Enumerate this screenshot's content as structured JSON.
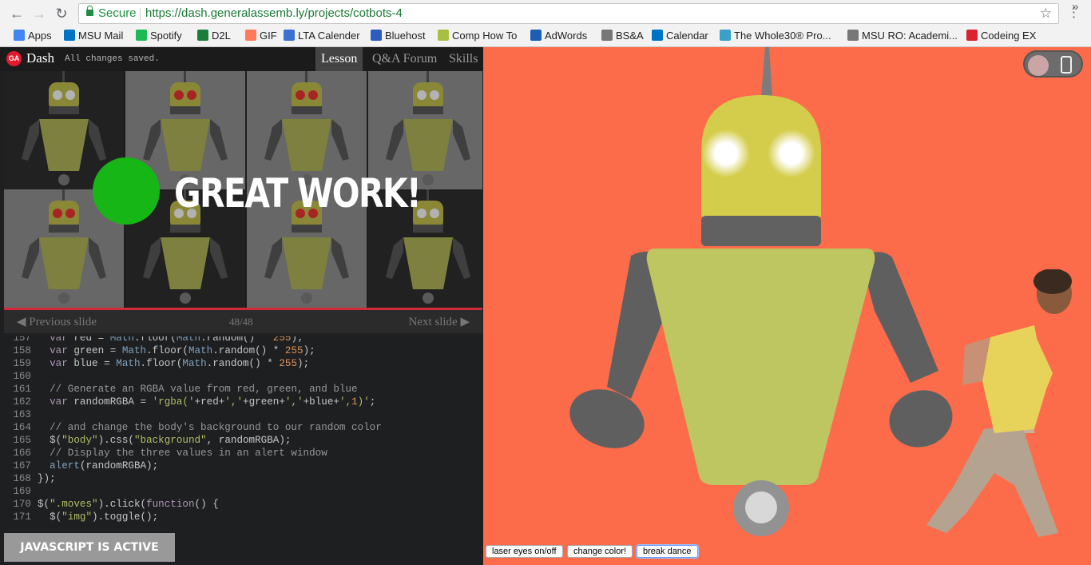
{
  "browser": {
    "secure_label": "Secure",
    "url": "https://dash.generalassemb.ly/projects/cotbots-4",
    "bookmarks": [
      {
        "label": "Apps",
        "icon": "apps-grid-icon",
        "color": "#4285f4"
      },
      {
        "label": "MSU Mail",
        "icon": "outlook-icon",
        "color": "#0072c6"
      },
      {
        "label": "Spotify",
        "icon": "spotify-icon",
        "color": "#1db954"
      },
      {
        "label": "D2L",
        "icon": "d2l-icon",
        "color": "#1a7e3b"
      },
      {
        "label": "GIF",
        "icon": "hubspot-icon",
        "color": "#ff7a59"
      },
      {
        "label": "LTA Calender",
        "icon": "calendar-icon",
        "color": "#3b6fd4"
      },
      {
        "label": "Bluehost",
        "icon": "bluehost-grid-icon",
        "color": "#2d5bbf"
      },
      {
        "label": "Comp How To",
        "icon": "comp-how-to-icon",
        "color": "#a8c040"
      },
      {
        "label": "AdWords",
        "icon": "globe-icon",
        "color": "#1a5fb4"
      },
      {
        "label": "BS&A",
        "icon": "page-icon",
        "color": "#777777"
      },
      {
        "label": "Calendar",
        "icon": "outlook-icon",
        "color": "#0072c6"
      },
      {
        "label": "The Whole30® Pro...",
        "icon": "whole30-icon",
        "color": "#3aa0c8"
      },
      {
        "label": "MSU RO: Academi...",
        "icon": "page-icon",
        "color": "#777777"
      },
      {
        "label": "Codeing EX",
        "icon": "codecademy-icon",
        "color": "#d9232d"
      }
    ]
  },
  "dash": {
    "logo": "GA",
    "title": "Dash",
    "status": "All changes saved.",
    "tabs": {
      "lesson": "Lesson",
      "qa": "Q&A Forum",
      "skills": "Skills"
    },
    "slide_message": "GREAT WORK!",
    "prev_label": "Previous slide",
    "next_label": "Next slide",
    "slide_counter": "48/48",
    "js_status": "JAVASCRIPT IS ACTIVE"
  },
  "code_lines": [
    {
      "n": "157",
      "text": "  var red = Math.floor(Math.random() * 255);"
    },
    {
      "n": "158",
      "text": "  var green = Math.floor(Math.random() * 255);"
    },
    {
      "n": "159",
      "text": "  var blue = Math.floor(Math.random() * 255);"
    },
    {
      "n": "160",
      "text": ""
    },
    {
      "n": "161",
      "text": "  // Generate an RGBA value from red, green, and blue"
    },
    {
      "n": "162",
      "text": "  var randomRGBA = 'rgba('+red+','+green+','+blue+',1)';"
    },
    {
      "n": "163",
      "text": ""
    },
    {
      "n": "164",
      "text": "  // and change the body's background to our random color"
    },
    {
      "n": "165",
      "text": "  $(\"body\").css(\"background\", randomRGBA);"
    },
    {
      "n": "166",
      "text": "  // Display the three values in an alert window"
    },
    {
      "n": "167",
      "text": "  alert(randomRGBA);"
    },
    {
      "n": "168",
      "text": "});"
    },
    {
      "n": "169",
      "text": ""
    },
    {
      "n": "170",
      "text": "$(\".moves\").click(function() {"
    },
    {
      "n": "171",
      "text": "  $(\"img\").toggle();"
    }
  ],
  "preview": {
    "background": "#fc6c4a",
    "buttons": {
      "laser": "laser eyes on/off",
      "color": "change color!",
      "dance": "break dance"
    }
  }
}
